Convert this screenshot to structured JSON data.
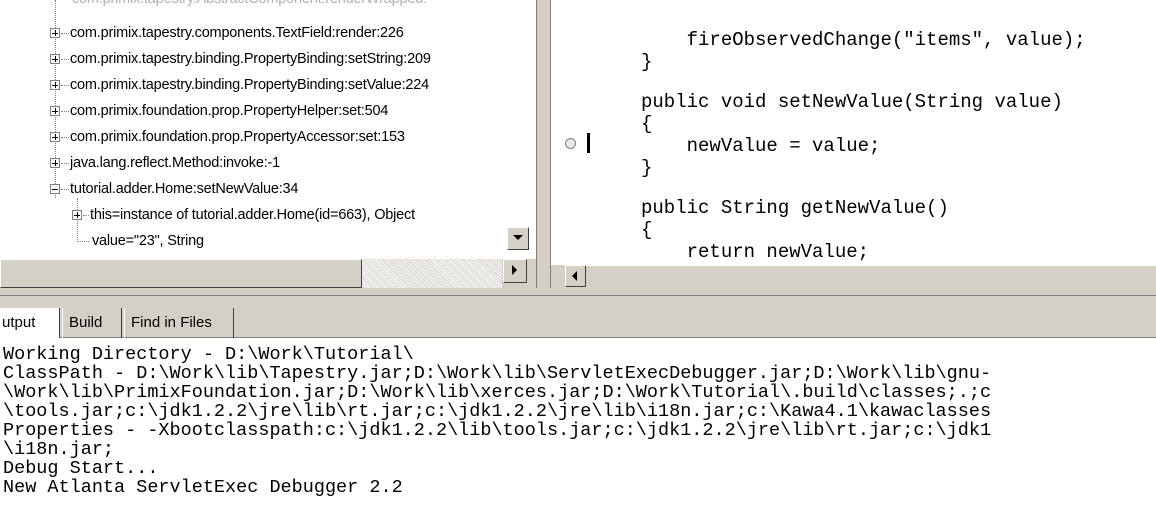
{
  "call_stack": {
    "items": [
      {
        "label": "com.primix.tapestry.AbstractComponent.renderWrapped:",
        "state": "clipped"
      },
      {
        "label": "com.primix.tapestry.components.TextField:render:226",
        "state": "collapsed"
      },
      {
        "label": "com.primix.tapestry.binding.PropertyBinding:setString:209",
        "state": "collapsed"
      },
      {
        "label": "com.primix.tapestry.binding.PropertyBinding:setValue:224",
        "state": "collapsed"
      },
      {
        "label": "com.primix.foundation.prop.PropertyHelper:set:504",
        "state": "collapsed"
      },
      {
        "label": "com.primix.foundation.prop.PropertyAccessor:set:153",
        "state": "collapsed"
      },
      {
        "label": "java.lang.reflect.Method:invoke:-1",
        "state": "collapsed"
      },
      {
        "label": "tutorial.adder.Home:setNewValue:34",
        "state": "expanded"
      }
    ],
    "children": [
      {
        "label": "this=instance of tutorial.adder.Home(id=663), Object",
        "state": "collapsed"
      },
      {
        "label": "value=\"23\", String",
        "state": "leaf"
      }
    ]
  },
  "source": {
    "lines": [
      "    fireObservedChange(\"items\", value);",
      "}",
      "",
      "public void setNewValue(String value)",
      "{",
      "    newValue = value;",
      "}",
      "",
      "public String getNewValue()",
      "{",
      "    return newValue;"
    ]
  },
  "output": {
    "tabs": [
      {
        "label": "utput",
        "active": true
      },
      {
        "label": "Build",
        "active": false
      },
      {
        "label": "Find in Files",
        "active": false
      }
    ],
    "lines": [
      "Working Directory - D:\\Work\\Tutorial\\",
      "ClassPath - D:\\Work\\lib\\Tapestry.jar;D:\\Work\\lib\\ServletExecDebugger.jar;D:\\Work\\lib\\gnu-",
      "\\Work\\lib\\PrimixFoundation.jar;D:\\Work\\lib\\xerces.jar;D:\\Work\\Tutorial\\.build\\classes;.;c",
      "\\tools.jar;c:\\jdk1.2.2\\jre\\lib\\rt.jar;c:\\jdk1.2.2\\jre\\lib\\i18n.jar;c:\\Kawa4.1\\kawaclasses",
      "Properties - -Xbootclasspath:c:\\jdk1.2.2\\lib\\tools.jar;c:\\jdk1.2.2\\jre\\lib\\rt.jar;c:\\jdk1",
      "\\i18n.jar;",
      "Debug Start...",
      "New Atlanta ServletExec Debugger 2.2"
    ]
  }
}
